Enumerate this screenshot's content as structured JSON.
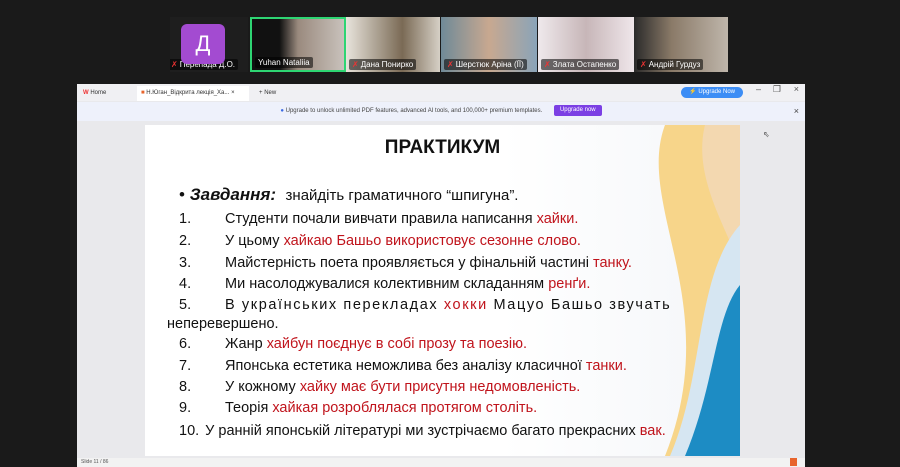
{
  "participants": [
    {
      "name": "Перепада Д.О.",
      "initial": "Д",
      "muted": true
    },
    {
      "name": "Yuhan Nataliia",
      "muted": false,
      "active": true
    },
    {
      "name": "Дана Понирко",
      "muted": true
    },
    {
      "name": "Шерстюк Аріна (ЇЇ)",
      "muted": true
    },
    {
      "name": "Злата Остапенко",
      "muted": true
    },
    {
      "name": "Андрій Гурдуз",
      "muted": true
    }
  ],
  "browser": {
    "tab_home": "Home",
    "tab_doc": "Н.Юган_Відкрита лекція_Ха...",
    "tab_new": "New",
    "upgrade_btn": "Upgrade Now",
    "banner_text": "Upgrade to unlock unlimited PDF features, advanced AI tools, and 100,000+ premium templates.",
    "banner_btn": "Upgrade now",
    "status": "Slide 11 / 86"
  },
  "slide": {
    "title": "ПРАКТИКУМ",
    "task_label": "Завдання:",
    "task_text": "знайдіть граматичного “шпигуна”.",
    "items": [
      {
        "n": "1.",
        "pre": "Студенти почали вивчати правила написання ",
        "red": "хайки",
        "post": "."
      },
      {
        "n": "2.",
        "pre": "У цьому ",
        "red": "хайкаю",
        "post": " Башьо використовує сезонне слово."
      },
      {
        "n": "3.",
        "pre": "Майстерність поета проявляється у фінальній частині ",
        "red": "танку",
        "post": "."
      },
      {
        "n": "4.",
        "pre": "Ми насолоджувалися колективним складанням ",
        "red": "ренґи",
        "post": "."
      },
      {
        "n": "5.",
        "pre": "В українських перекладах ",
        "red": "хокки",
        "post": " Мацуо Башьо звучать",
        "cont": "неперевершено."
      },
      {
        "n": "6.",
        "pre": "Жанр ",
        "red": "хайбун",
        "post": " поєднує в собі прозу та поезію."
      },
      {
        "n": "7.",
        "pre": "Японська естетика неможлива без аналізу класичної ",
        "red": "танки",
        "post": "."
      },
      {
        "n": "8.",
        "pre": "У кожному ",
        "red": "хайку",
        "post": " має бути присутня недомовленість."
      },
      {
        "n": "9.",
        "pre": "Теорія ",
        "red": "хайкая",
        "post": " розроблялася протягом століть."
      },
      {
        "n": "10.",
        "pre": "У ранній японській літературі ми зустрічаємо багато прекрасних ",
        "red": "вак",
        "post": "."
      }
    ]
  }
}
